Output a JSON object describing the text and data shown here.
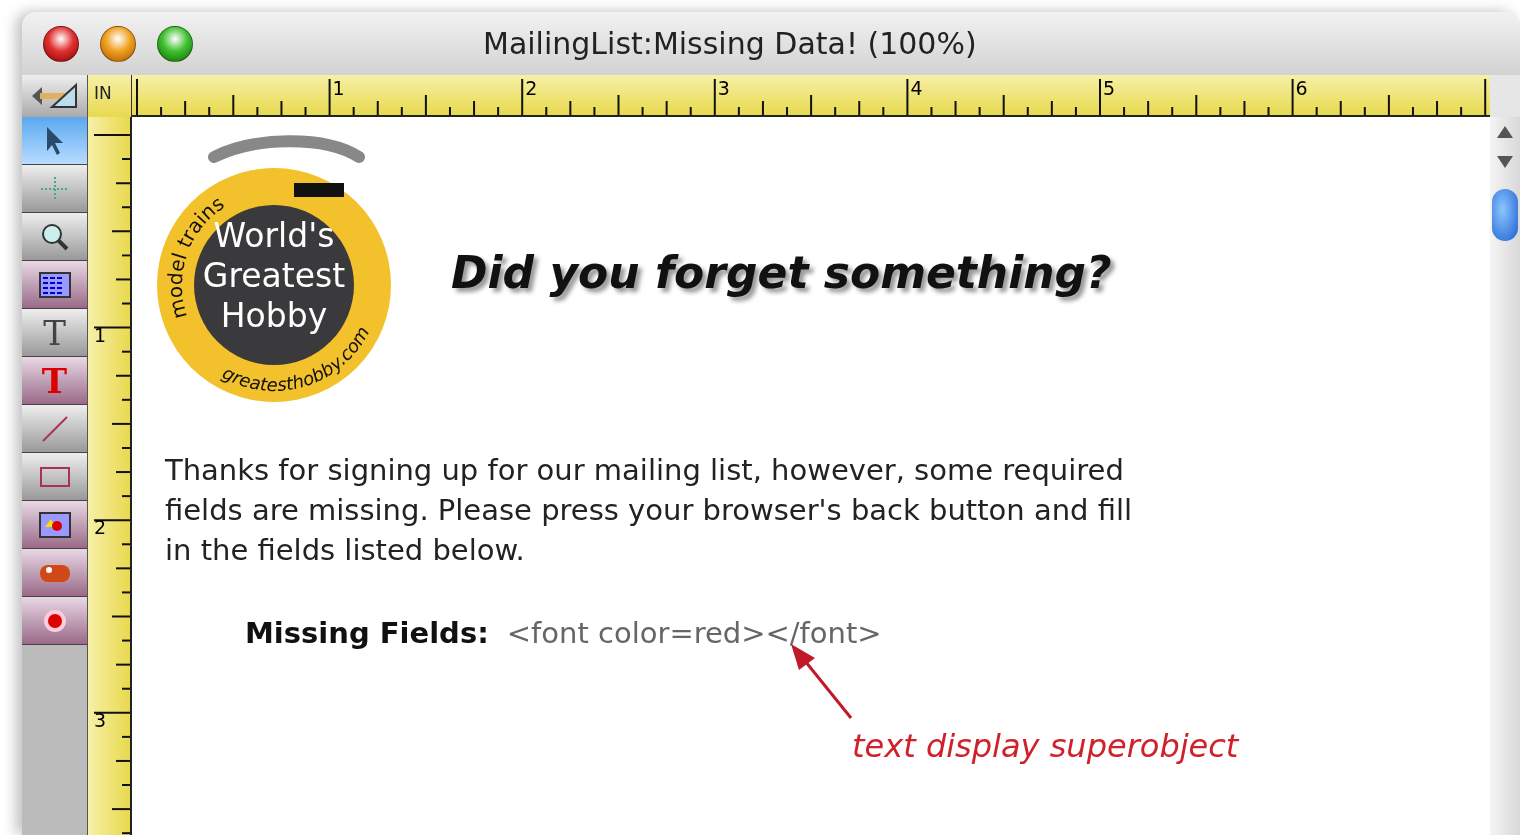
{
  "window": {
    "title": "MailingList:Missing Data! (100%)"
  },
  "ruler": {
    "unit": "IN",
    "h_labels": [
      "1",
      "2",
      "3",
      "4",
      "5",
      "6"
    ],
    "v_labels": [
      "1",
      "2",
      "3"
    ]
  },
  "tools": [
    {
      "kind": "pointer",
      "selected": true
    },
    {
      "kind": "crosshair",
      "selected": false
    },
    {
      "kind": "magnifier",
      "selected": false
    },
    {
      "kind": "list",
      "selected": false
    },
    {
      "kind": "text",
      "glyph": "T",
      "selected": false
    },
    {
      "kind": "styled-text",
      "glyph": "T",
      "selected": false
    },
    {
      "kind": "line",
      "selected": false
    },
    {
      "kind": "rect",
      "selected": false
    },
    {
      "kind": "picture",
      "selected": false
    },
    {
      "kind": "button",
      "selected": false
    },
    {
      "kind": "radio",
      "selected": false
    }
  ],
  "logo": {
    "arc_top": "model trains",
    "center": "World's Greatest Hobby",
    "arc_bottom": "greatesthobby.com"
  },
  "heading": "Did you forget something?",
  "message": "Thanks for signing up for our mailing list, however, some required fields are missing. Please press your browser's back button and fill in the fields listed below.",
  "missing_fields": {
    "label": "Missing Fields:",
    "value": "<font color=red></font>"
  },
  "annotation": "text display superobject"
}
